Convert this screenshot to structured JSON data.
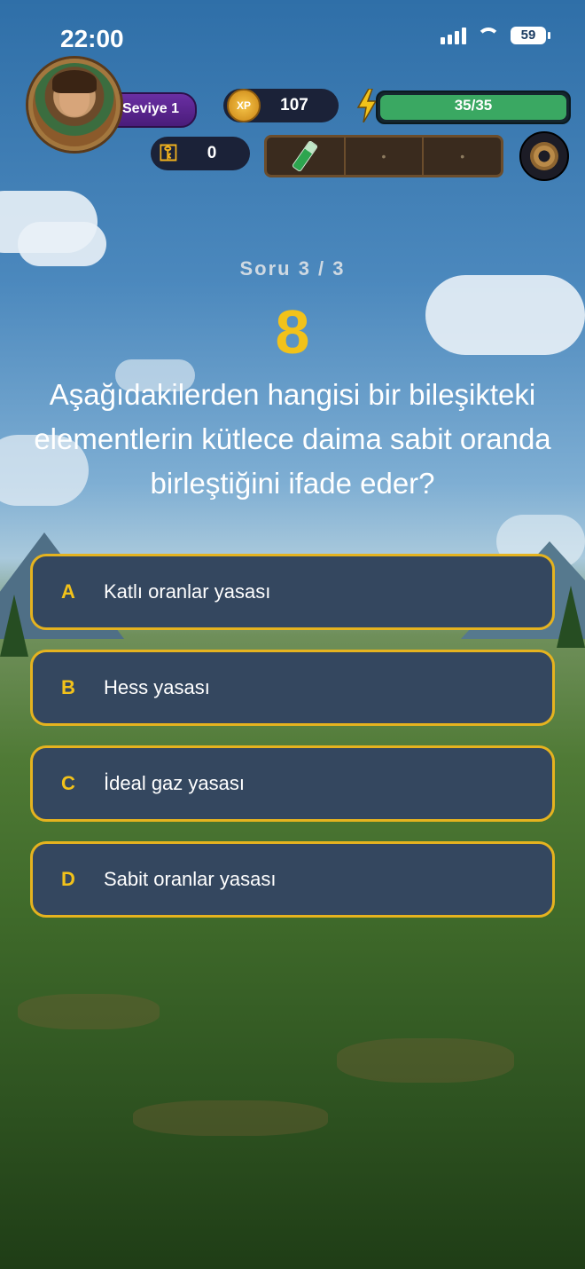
{
  "status": {
    "time": "22:00",
    "battery": "59"
  },
  "profile": {
    "level_label": "Seviye 1"
  },
  "stats": {
    "xp_badge": "XP",
    "xp": "107",
    "energy": "35/35",
    "energy_fraction": 1.0,
    "keys": "0"
  },
  "question": {
    "counter": "Soru 3 / 3",
    "timer": "8",
    "text": "Aşağıdakilerden hangisi bir bileşikteki elementlerin kütlece daima sabit oranda birleştiğini ifade eder?"
  },
  "options": [
    {
      "letter": "A",
      "text": "Katlı oranlar yasası"
    },
    {
      "letter": "B",
      "text": "Hess yasası"
    },
    {
      "letter": "C",
      "text": "İdeal gaz yasası"
    },
    {
      "letter": "D",
      "text": "Sabit oranlar yasası"
    }
  ],
  "colors": {
    "accent": "#e5b31f",
    "option_bg": "#34475f",
    "energy": "#3aa862"
  }
}
